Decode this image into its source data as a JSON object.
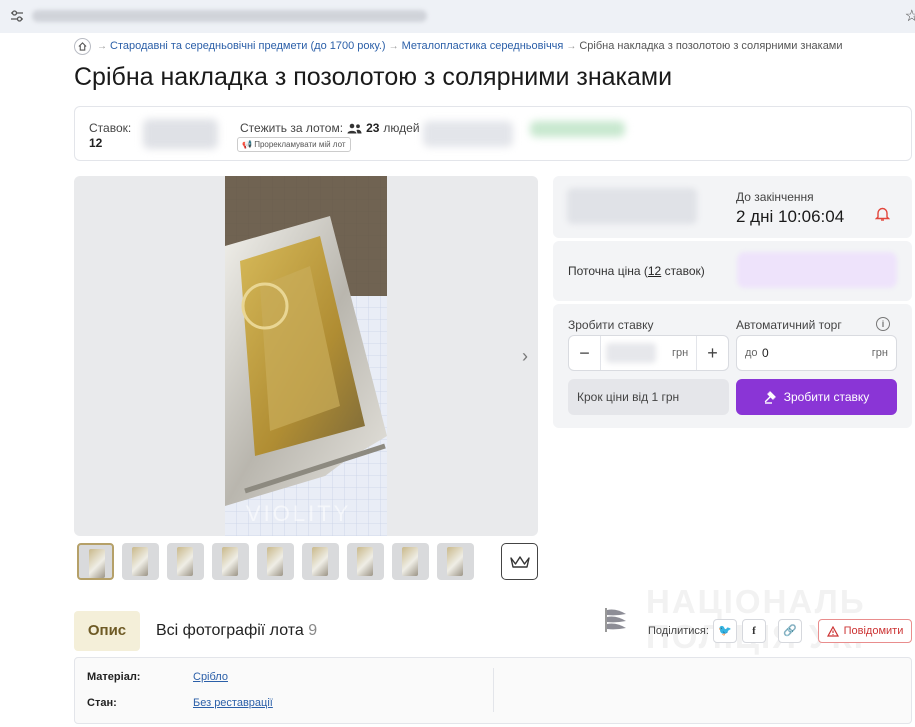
{
  "breadcrumb": {
    "items": [
      "Стародавні та середньовічні предмети (до 1700 року.)",
      "Металопластика середньовіччя",
      "Срібна накладка з позолотою з солярними знаками"
    ]
  },
  "page_title": "Срібна накладка з позолотою з солярними знаками",
  "info": {
    "bids_label": "Ставок:",
    "bids_value": "12",
    "watch_label": "Стежить за лотом:",
    "watch_count": "23",
    "watch_unit": "людей",
    "promo_label": "Прорекламувати мій лот"
  },
  "gallery": {
    "watermark": "VIOLITY",
    "thumbnail_count": 9
  },
  "auction": {
    "end_label": "До закінчення",
    "end_value": "2 дні 10:06:04",
    "price_label_prefix": "Поточна ціна (",
    "price_bids": "12",
    "price_label_suffix": " ставок)",
    "bid_label": "Зробити ставку",
    "auto_label": "Автоматичний торг",
    "currency": "грн",
    "auto_prefix": "до",
    "auto_value": "0",
    "step_label": "Крок ціни від 1 грн",
    "bid_button": "Зробити ставку"
  },
  "tabs": {
    "description": "Опис",
    "all_photos": "Всі фотографії лота",
    "photos_count": "9"
  },
  "share": {
    "label": "Поділитися:",
    "report": "Повідомити"
  },
  "overlay_text": [
    "НАЦІОНАЛЬ",
    "ПОЛІЦІЯ УКР"
  ],
  "props": [
    {
      "key": "Матеріал:",
      "value": "Срібло"
    },
    {
      "key": "Стан:",
      "value": "Без реставрації"
    }
  ],
  "colors": {
    "accent": "#8a35d6",
    "link": "#2b5fa8",
    "tab_bg": "#f4efd9"
  }
}
